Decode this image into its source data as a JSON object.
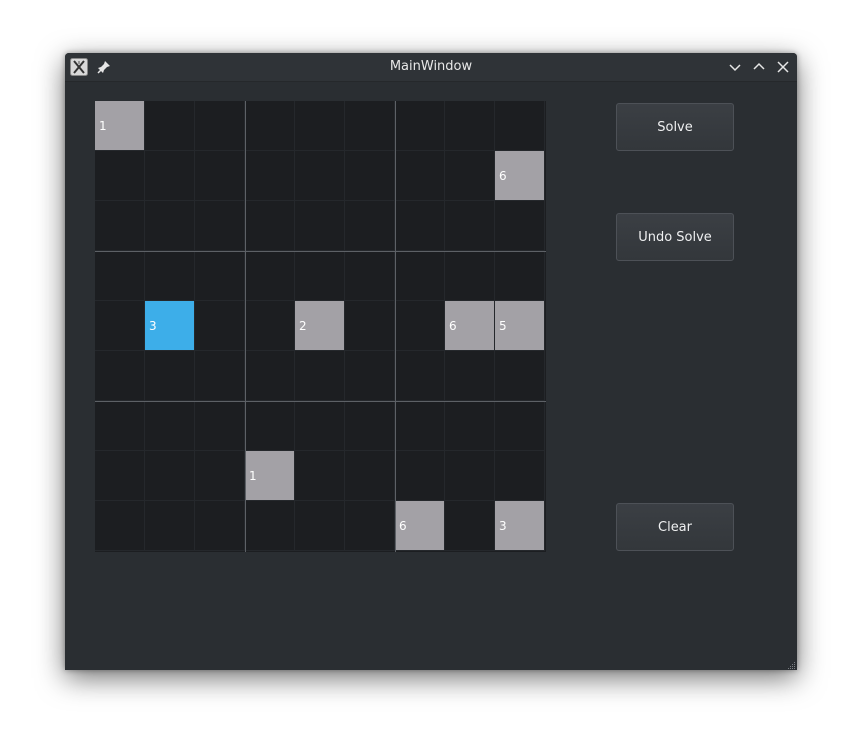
{
  "window": {
    "title": "MainWindow"
  },
  "titlebar_icons": {
    "app": "app-icon",
    "pin": "pin-icon",
    "minimize": "chevron-down-icon",
    "maximize": "chevron-up-icon",
    "close": "close-icon"
  },
  "buttons": {
    "solve": "Solve",
    "undo_solve": "Undo Solve",
    "clear": "Clear"
  },
  "board": {
    "rows": [
      [
        "1",
        "",
        "",
        "",
        "",
        "",
        "",
        "",
        ""
      ],
      [
        "",
        "",
        "",
        "",
        "",
        "",
        "",
        "",
        "6"
      ],
      [
        "",
        "",
        "",
        "",
        "",
        "",
        "",
        "",
        ""
      ],
      [
        "",
        "",
        "",
        "",
        "",
        "",
        "",
        "",
        ""
      ],
      [
        "",
        "3",
        "",
        "",
        "2",
        "",
        "",
        "6",
        "5"
      ],
      [
        "",
        "",
        "",
        "",
        "",
        "",
        "",
        "",
        ""
      ],
      [
        "",
        "",
        "",
        "",
        "",
        "",
        "",
        "",
        ""
      ],
      [
        "",
        "",
        "",
        "1",
        "",
        "",
        "",
        "",
        ""
      ],
      [
        "",
        "",
        "",
        "",
        "",
        "",
        "6",
        "",
        "3"
      ]
    ],
    "selected_cell": {
      "row": 4,
      "col": 1
    }
  },
  "colors": {
    "window_bg": "#2a2e32",
    "grid_bg": "#1c1e21",
    "given_cell": "#a3a1a6",
    "selected_cell": "#3daee9",
    "box_divider": "#5d6166"
  }
}
